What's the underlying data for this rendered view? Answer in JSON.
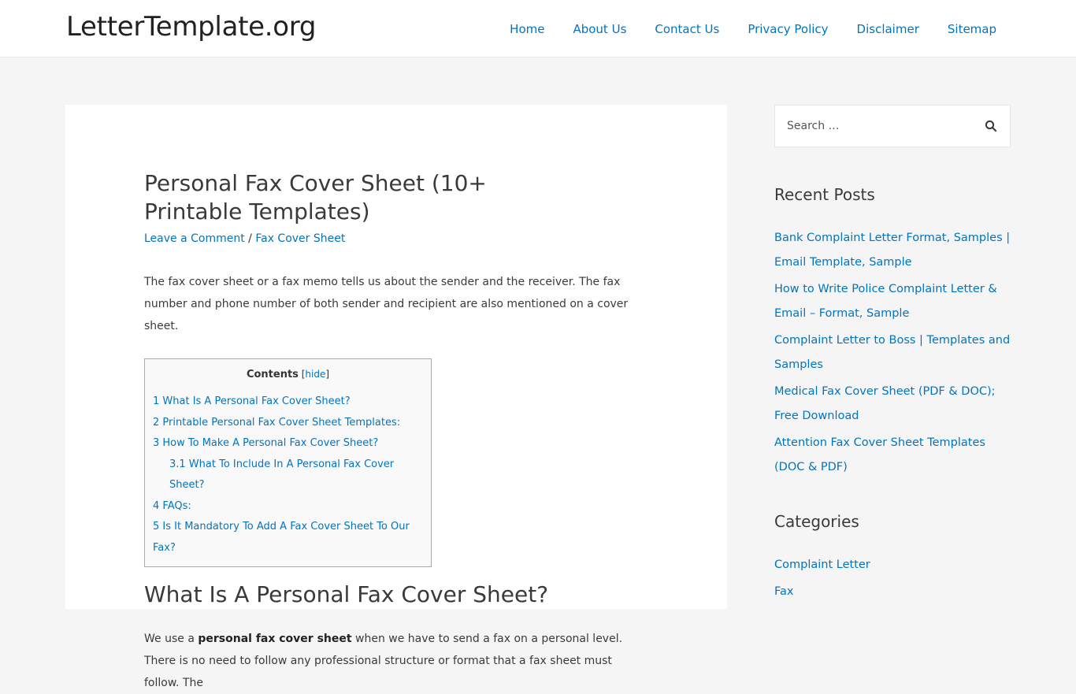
{
  "header": {
    "site_title": "LetterTemplate.org",
    "nav": [
      "Home",
      "About Us",
      "Contact Us",
      "Privacy Policy",
      "Disclaimer",
      "Sitemap"
    ]
  },
  "article": {
    "title": "Personal Fax Cover Sheet (10+ Printable Templates)",
    "meta": {
      "comment_link": "Leave a Comment",
      "separator": " / ",
      "category_link": "Fax Cover Sheet"
    },
    "intro": "The fax cover sheet or a fax memo tells us about the sender and the receiver. The fax number and phone number of both sender and recipient are also mentioned on a cover sheet.",
    "toc": {
      "heading": "Contents",
      "hide_open": " [",
      "hide_label": "hide",
      "hide_close": "]",
      "items": [
        "1 What Is A Personal Fax Cover Sheet?",
        "2 Printable Personal Fax Cover Sheet Templates:",
        "3 How To Make A Personal Fax Cover Sheet?",
        "3.1 What To Include In A Personal Fax Cover Sheet?",
        "4 FAQs:",
        "5 Is It Mandatory To Add A Fax Cover Sheet To Our Fax?"
      ]
    },
    "section_heading": "What Is A Personal Fax Cover Sheet?",
    "section_para": {
      "before": "We use a ",
      "bold": "personal fax cover sheet",
      "after": " when we have to send a fax on a personal level. There is no need to follow any professional structure or format that a fax sheet must follow. The"
    }
  },
  "sidebar": {
    "search": {
      "placeholder": "Search …",
      "icon": "search-icon"
    },
    "recent_posts": {
      "title": "Recent Posts",
      "items": [
        "Bank Complaint Letter Format, Samples | Email Template, Sample",
        "How to Write Police Complaint Letter & Email – Format, Sample",
        "Complaint Letter to Boss | Templates and Samples",
        "Medical Fax Cover Sheet (PDF & DOC); Free Download",
        "Attention Fax Cover Sheet Templates (DOC & PDF)"
      ]
    },
    "categories": {
      "title": "Categories",
      "items": [
        "Complaint Letter",
        "Fax"
      ]
    }
  },
  "colors": {
    "link": "#0274be",
    "text": "#3a3a3a",
    "background": "#f5f5f5",
    "card": "#ffffff"
  }
}
